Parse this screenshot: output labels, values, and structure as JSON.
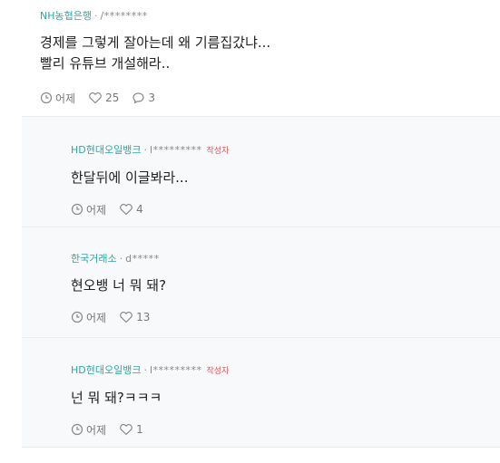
{
  "comments": [
    {
      "bank": "NH농협은행",
      "sep": "·",
      "user": "/********",
      "lines": [
        "경제를 그렇게 잘아는데 왜 기름집갔냐...",
        "빨리 유튜브 개설해라.."
      ],
      "time": "어제",
      "likes": "25",
      "replies": "3"
    },
    {
      "bank": "HD현대오일뱅크",
      "sep": "·",
      "user": "l*********",
      "author_badge": "작성자",
      "lines": [
        "한달뒤에 이글봐라..."
      ],
      "time": "어제",
      "likes": "4"
    },
    {
      "bank": "한국거래소",
      "sep": "·",
      "user": "d*****",
      "lines": [
        "현오뱅 너 뭐 돼?"
      ],
      "time": "어제",
      "likes": "13"
    },
    {
      "bank": "HD현대오일뱅크",
      "sep": "·",
      "user": "l*********",
      "author_badge": "작성자",
      "lines": [
        "넌 뭐 돼?ㅋㅋㅋ"
      ],
      "time": "어제",
      "likes": "1"
    }
  ],
  "icons": {
    "time": "clock-icon",
    "like": "heart-icon",
    "reply": "speech-bubble-icon"
  },
  "colors": {
    "bank": "#2ea7a0",
    "author_badge": "#e0565b",
    "reply_bg": "#f8f9fa"
  }
}
